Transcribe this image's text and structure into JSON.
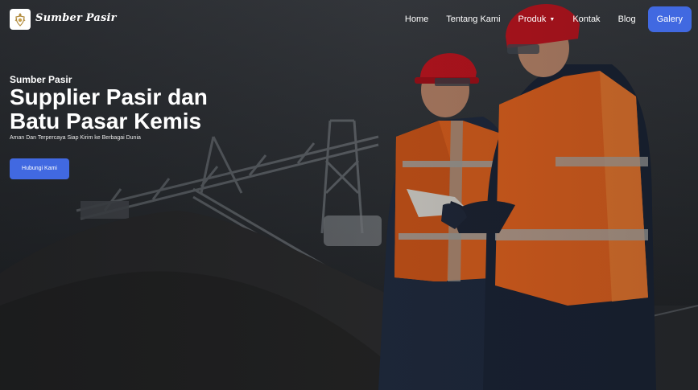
{
  "brand": {
    "name": "Sumber Pasir",
    "logo_icon": "crest-logo-icon"
  },
  "nav": {
    "items": [
      {
        "label": "Home"
      },
      {
        "label": "Tentang Kami"
      },
      {
        "label": "Produk",
        "has_dropdown": true
      },
      {
        "label": "Kontak"
      },
      {
        "label": "Blog"
      }
    ],
    "cta_label": "Galery"
  },
  "hero": {
    "eyebrow": "Sumber Pasir",
    "title": "Supplier Pasir dan Batu Pasar Kemis",
    "subtitle": "Aman Dan Terpercaya Siap Kirim ke Berbagai Dunia",
    "button_label": "Hubungi Kami",
    "background": "two-workers-hard-hats-mining-site-photo"
  },
  "colors": {
    "accent": "#4169e1",
    "vest": "#e8641e",
    "helmet": "#c4141e",
    "text": "#ffffff"
  }
}
